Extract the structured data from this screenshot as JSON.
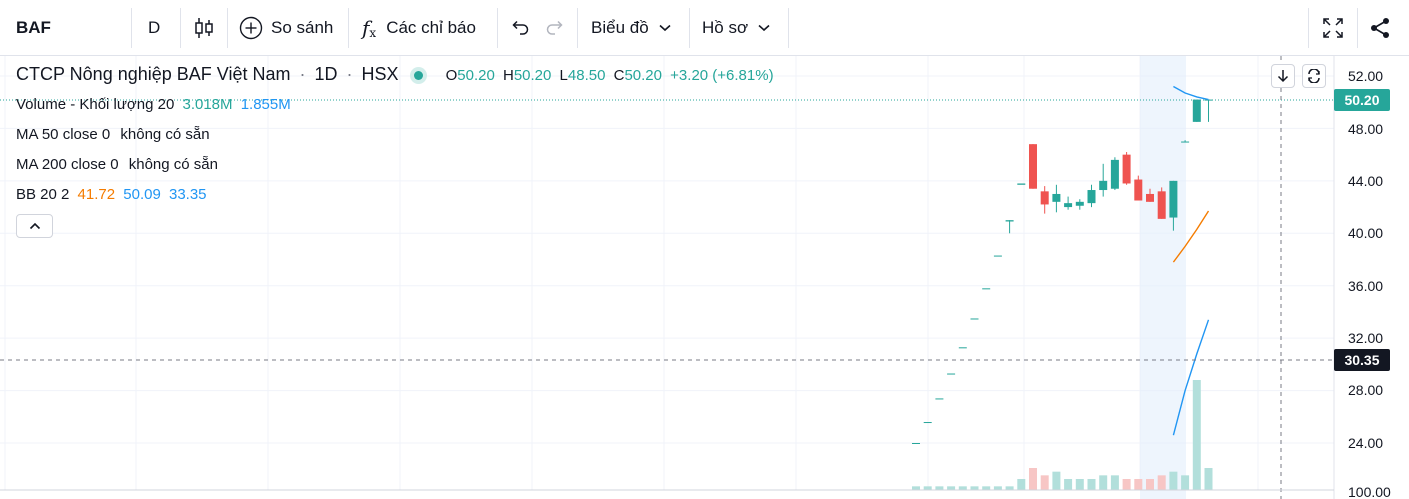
{
  "toolbar": {
    "symbol": "BAF",
    "interval": "D",
    "compare_label": "So sánh",
    "indicators_label": "Các chỉ báo",
    "chart_type_label": "Biểu đồ",
    "profile_label": "Hồ sơ"
  },
  "legend": {
    "title": "CTCP Nông nghiệp BAF Việt Nam",
    "sep1": "·",
    "interval": "1D",
    "sep2": "·",
    "exchange": "HSX",
    "o_label": "O",
    "o_value": "50.20",
    "h_label": "H",
    "h_value": "50.20",
    "l_label": "L",
    "l_value": "48.50",
    "c_label": "C",
    "c_value": "50.20",
    "change": "+3.20 (+6.81%)",
    "volume_label": "Volume - Khối lượng 20",
    "volume_value": "3.018M",
    "volume_ma": "1.855M",
    "ma50_label": "MA 50 close 0",
    "ma50_value": "không có sẵn",
    "ma200_label": "MA 200 close 0",
    "ma200_value": "không có sẵn",
    "bb_label": "BB 20 2",
    "bb_basis": "41.72",
    "bb_upper": "50.09",
    "bb_lower": "33.35"
  },
  "price_axis": {
    "ticks": [
      "52.00",
      "48.00",
      "44.00",
      "40.00",
      "36.00",
      "32.00",
      "28.00",
      "24.00"
    ],
    "volume_tick": "100.00",
    "last_price": "50.20",
    "crosshair_price": "30.35"
  },
  "colors": {
    "up": "#26a69a",
    "down": "#ef5350",
    "bb_upper": "#2196f3",
    "bb_lower": "#f57c00",
    "vol_up": "#b2dfdb",
    "vol_down": "#f7c6c5"
  },
  "chart_data": {
    "type": "candlestick",
    "ylim": [
      22,
      53.5
    ],
    "candles": [
      {
        "o": 24.0,
        "h": 24.0,
        "l": 24.0,
        "c": 24.0,
        "v": 1
      },
      {
        "o": 25.6,
        "h": 25.6,
        "l": 25.6,
        "c": 25.6,
        "v": 1
      },
      {
        "o": 27.4,
        "h": 27.4,
        "l": 27.4,
        "c": 27.4,
        "v": 1
      },
      {
        "o": 29.3,
        "h": 29.3,
        "l": 29.3,
        "c": 29.3,
        "v": 1
      },
      {
        "o": 31.3,
        "h": 31.3,
        "l": 31.3,
        "c": 31.3,
        "v": 1
      },
      {
        "o": 33.5,
        "h": 33.5,
        "l": 33.5,
        "c": 33.5,
        "v": 1
      },
      {
        "o": 35.8,
        "h": 35.8,
        "l": 35.8,
        "c": 35.8,
        "v": 1
      },
      {
        "o": 38.3,
        "h": 38.3,
        "l": 38.3,
        "c": 38.3,
        "v": 1
      },
      {
        "o": 40.9,
        "h": 41.0,
        "l": 40.0,
        "c": 41.0,
        "v": 1
      },
      {
        "o": 43.7,
        "h": 43.7,
        "l": 43.7,
        "c": 43.8,
        "v": 3
      },
      {
        "o": 46.8,
        "h": 46.8,
        "l": 43.4,
        "c": 43.4,
        "v": 6
      },
      {
        "o": 43.2,
        "h": 43.6,
        "l": 41.5,
        "c": 42.2,
        "v": 4
      },
      {
        "o": 42.4,
        "h": 43.7,
        "l": 41.6,
        "c": 43.0,
        "v": 5
      },
      {
        "o": 42.0,
        "h": 42.8,
        "l": 41.8,
        "c": 42.3,
        "v": 3
      },
      {
        "o": 42.1,
        "h": 42.6,
        "l": 41.8,
        "c": 42.4,
        "v": 3
      },
      {
        "o": 42.3,
        "h": 43.7,
        "l": 42.0,
        "c": 43.3,
        "v": 3
      },
      {
        "o": 43.3,
        "h": 45.3,
        "l": 42.8,
        "c": 44.0,
        "v": 4
      },
      {
        "o": 43.4,
        "h": 45.8,
        "l": 43.3,
        "c": 45.6,
        "v": 4
      },
      {
        "o": 46.0,
        "h": 46.2,
        "l": 43.7,
        "c": 43.8,
        "v": 3
      },
      {
        "o": 44.1,
        "h": 44.4,
        "l": 42.5,
        "c": 42.5,
        "v": 3
      },
      {
        "o": 43.0,
        "h": 43.4,
        "l": 42.4,
        "c": 42.4,
        "v": 3
      },
      {
        "o": 43.2,
        "h": 43.5,
        "l": 41.1,
        "c": 41.1,
        "v": 4
      },
      {
        "o": 41.2,
        "h": 44.0,
        "l": 40.2,
        "c": 44.0,
        "v": 5
      },
      {
        "o": 47.0,
        "h": 47.1,
        "l": 47.0,
        "c": 47.0,
        "v": 4
      },
      {
        "o": 48.5,
        "h": 50.2,
        "l": 48.5,
        "c": 50.2,
        "v": 30
      },
      {
        "o": 50.2,
        "h": 50.2,
        "l": 48.5,
        "c": 50.2,
        "v": 6
      }
    ],
    "bb_upper": [
      null,
      null,
      null,
      null,
      null,
      null,
      null,
      null,
      null,
      null,
      null,
      null,
      null,
      null,
      null,
      null,
      null,
      null,
      null,
      null,
      null,
      null,
      51.2,
      50.7,
      50.4,
      50.2
    ],
    "bb_lower": [
      null,
      null,
      null,
      null,
      null,
      null,
      null,
      null,
      null,
      null,
      null,
      null,
      null,
      null,
      null,
      null,
      null,
      null,
      null,
      null,
      null,
      null,
      37.8,
      39.0,
      40.3,
      41.7
    ],
    "bb_basis": [
      null,
      null,
      null,
      null,
      null,
      null,
      null,
      null,
      null,
      null,
      null,
      null,
      null,
      null,
      null,
      null,
      null,
      null,
      null,
      null,
      null,
      null,
      24.6,
      28.0,
      30.8,
      33.4
    ]
  }
}
